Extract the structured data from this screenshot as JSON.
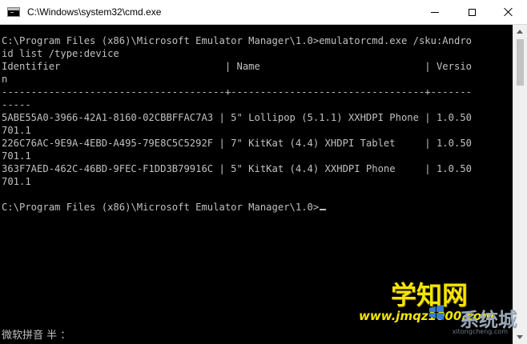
{
  "window": {
    "title": "C:\\Windows\\system32\\cmd.exe"
  },
  "console": {
    "lines": [
      "C:\\Program Files (x86)\\Microsoft Emulator Manager\\1.0>emulatorcmd.exe /sku:Andro",
      "id list /type:device",
      "Identifier                            | Name                            | Versio",
      "n",
      "--------------------------------------+---------------------------------+-------",
      "-----",
      "5ABE55A0-3966-42A1-8160-02CBBFFAC7A3 | 5\" Lollipop (5.1.1) XXHDPI Phone | 1.0.50",
      "701.1",
      "226C76AC-9E9A-4EBD-A495-79E8C5C5292F | 7\" KitKat (4.4) XHDPI Tablet     | 1.0.50",
      "701.1",
      "363F7AED-462C-46BD-9FEC-F1DD3B79916C | 5\" KitKat (4.4) XXHDPI Phone     | 1.0.50",
      "701.1",
      ""
    ],
    "prompt": "C:\\Program Files (x86)\\Microsoft Emulator Manager\\1.0>"
  },
  "ime": {
    "status": "微软拼音 半 ："
  },
  "watermark": {
    "main": "学知网",
    "url": "www.jmqz1000.com",
    "brand": "系统城",
    "sub": "xitongcheng.com"
  },
  "colors": {
    "console_bg": "#000000",
    "console_fg": "#c0c0c0",
    "titlebar_bg": "#ffffff",
    "watermark_yellow": "#f4e500",
    "watermark_blue": "#9aa7b6"
  },
  "icons": {
    "app": "cmd-icon",
    "minimize": "minimize-icon",
    "maximize": "maximize-icon",
    "close": "close-icon"
  }
}
